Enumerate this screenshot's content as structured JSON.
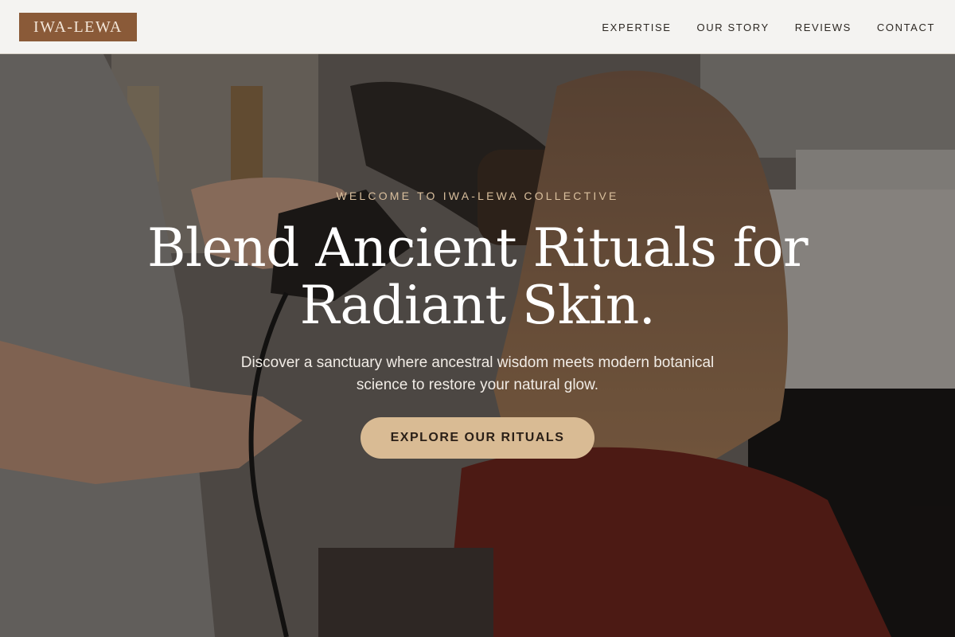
{
  "header": {
    "logo_text": "IWA-LEWA",
    "nav": [
      {
        "label": "EXPERTISE"
      },
      {
        "label": "OUR STORY"
      },
      {
        "label": "REVIEWS"
      },
      {
        "label": "CONTACT"
      }
    ]
  },
  "hero": {
    "eyebrow": "WELCOME TO IWA-LEWA COLLECTIVE",
    "headline_line1": "Blend Ancient Rituals for",
    "headline_line2": "Radiant Skin.",
    "subtext_line1": "Discover a sanctuary where ancestral wisdom meets modern botanical",
    "subtext_line2": "science to restore your natural glow.",
    "cta_label": "EXPLORE OUR RITUALS"
  },
  "colors": {
    "logo_bg": "#8a5a38",
    "accent": "#d9bb94",
    "eyebrow": "#d9bf9d",
    "header_bg": "#f4f3f1"
  }
}
